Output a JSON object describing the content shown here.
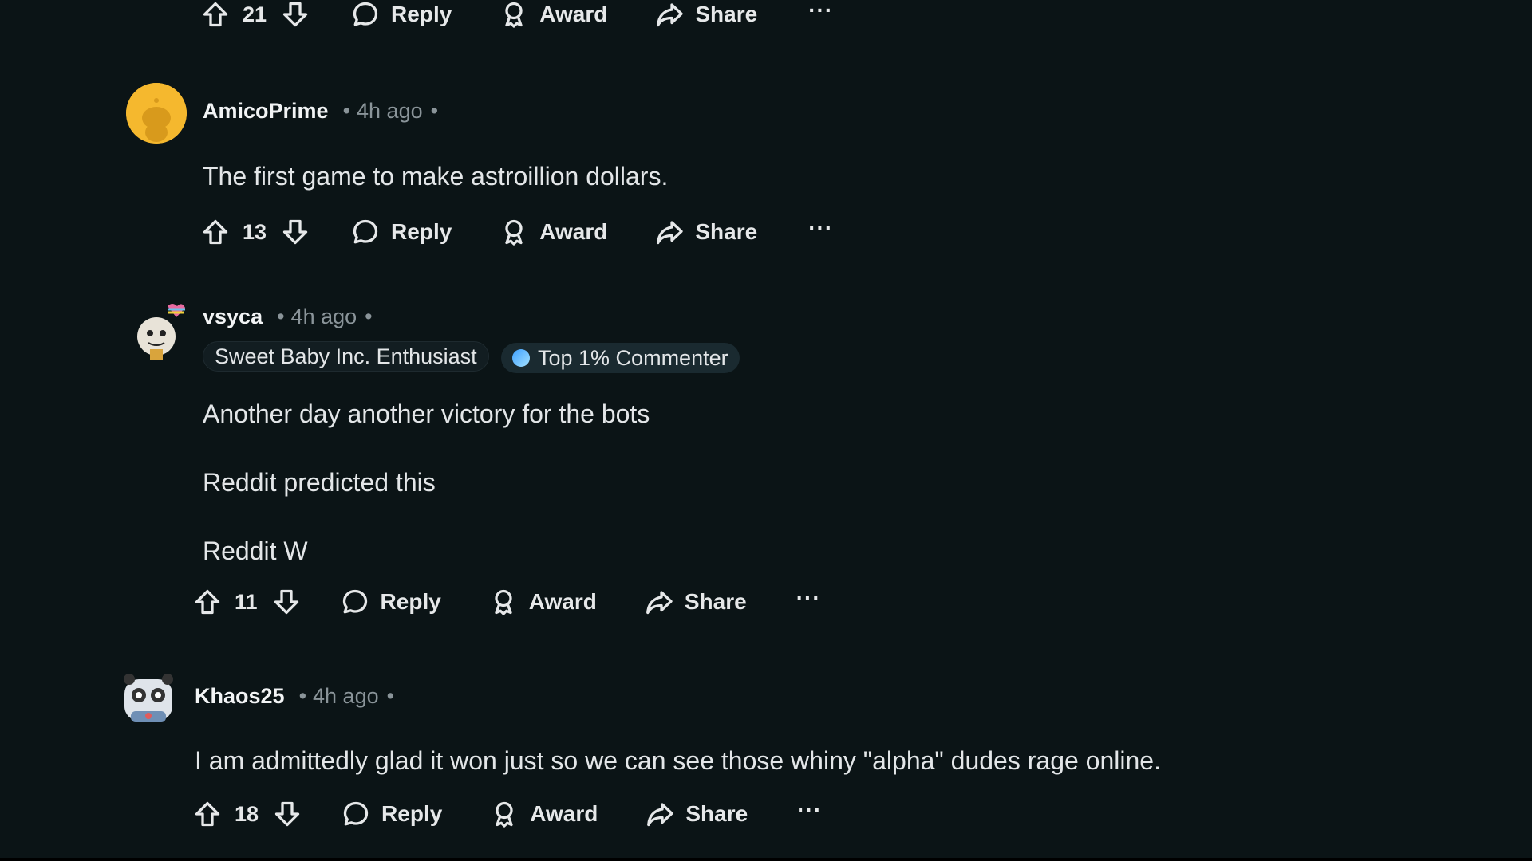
{
  "top_actions": {
    "votes": "21",
    "reply": "Reply",
    "award": "Award",
    "share": "Share",
    "more": "···"
  },
  "comments": [
    {
      "author": "AmicoPrime",
      "time": "4h ago",
      "avatar_color": "#f5b82e",
      "paragraphs": [
        "The first game to make astroillion dollars."
      ],
      "votes": "13",
      "reply": "Reply",
      "award": "Award",
      "share": "Share",
      "more": "···"
    },
    {
      "author": "vsyca",
      "time": "4h ago",
      "flairs": [
        "Sweet Baby Inc. Enthusiast",
        "Top 1% Commenter"
      ],
      "paragraphs": [
        "Another day another victory for the bots",
        "Reddit predicted this",
        "Reddit W"
      ],
      "votes": "11",
      "reply": "Reply",
      "award": "Award",
      "share": "Share",
      "more": "···"
    },
    {
      "author": "Khaos25",
      "time": "4h ago",
      "paragraphs": [
        "I am admittedly glad it won just so we can see those whiny \"alpha\" dudes rage online."
      ],
      "votes": "18",
      "reply": "Reply",
      "award": "Award",
      "share": "Share",
      "more": "···"
    }
  ],
  "separator_dot": "•",
  "icons": {
    "upvote": "arrow-up-icon",
    "downvote": "arrow-down-icon",
    "reply": "speech-bubble-icon",
    "award": "award-ribbon-icon",
    "share": "share-arrow-icon",
    "more": "ellipsis-icon"
  },
  "colors": {
    "background": "#0b1416",
    "text": "#e3e6e8",
    "meta": "#8a9499"
  }
}
